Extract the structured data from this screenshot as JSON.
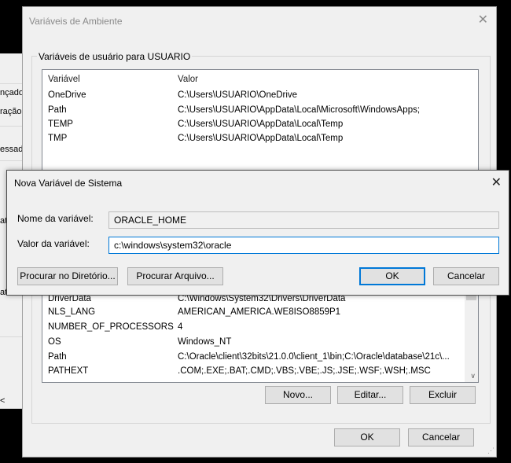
{
  "background_window": {
    "labels": [
      "nçado",
      "ração",
      "essad",
      "at",
      "ate",
      "te",
      "<"
    ]
  },
  "env_dialog": {
    "title": "Variáveis de Ambiente",
    "close_icon": "close-icon",
    "user_group_label": "Variáveis de usuário para USUARIO",
    "user_list": {
      "headers": [
        "Variável",
        "Valor"
      ],
      "rows": [
        [
          "OneDrive",
          "C:\\Users\\USUARIO\\OneDrive"
        ],
        [
          "Path",
          "C:\\Users\\USUARIO\\AppData\\Local\\Microsoft\\WindowsApps;"
        ],
        [
          "TEMP",
          "C:\\Users\\USUARIO\\AppData\\Local\\Temp"
        ],
        [
          "TMP",
          "C:\\Users\\USUARIO\\AppData\\Local\\Temp"
        ]
      ]
    },
    "system_list": {
      "rows": [
        [
          "DriverData",
          "C:\\Windows\\System32\\Drivers\\DriverData"
        ],
        [
          "NLS_LANG",
          "AMERICAN_AMERICA.WE8ISO8859P1"
        ],
        [
          "NUMBER_OF_PROCESSORS",
          "4"
        ],
        [
          "OS",
          "Windows_NT"
        ],
        [
          "Path",
          "C:\\Oracle\\client\\32bits\\21.0.0\\client_1\\bin;C:\\Oracle\\database\\21c\\..."
        ],
        [
          "PATHEXT",
          ".COM;.EXE;.BAT;.CMD;.VBS;.VBE;.JS;.JSE;.WSF;.WSH;.MSC"
        ]
      ],
      "new_label": "Novo...",
      "edit_label": "Editar...",
      "delete_label": "Excluir"
    },
    "ok_label": "OK",
    "cancel_label": "Cancelar"
  },
  "new_var_dialog": {
    "title": "Nova Variável de Sistema",
    "name_label": "Nome da variável:",
    "name_value": "ORACLE_HOME",
    "value_label": "Valor da variável:",
    "value_value": "c:\\windows\\system32\\oracle",
    "browse_dir_label": "Procurar no Diretório...",
    "browse_file_label": "Procurar Arquivo...",
    "ok_label": "OK",
    "cancel_label": "Cancelar"
  },
  "colors": {
    "accent": "#0078d7",
    "dialog_bg": "#f0f0f0"
  }
}
